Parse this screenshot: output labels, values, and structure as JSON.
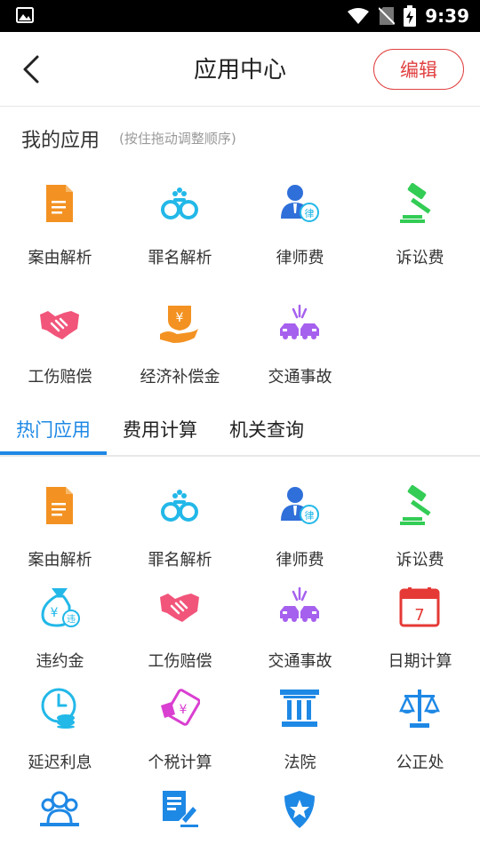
{
  "status_bar": {
    "time": "9:39"
  },
  "header": {
    "title": "应用中心",
    "edit_label": "编辑"
  },
  "my_apps": {
    "title": "我的应用",
    "hint": "(按住拖动调整顺序)",
    "items": [
      {
        "label": "案由解析",
        "icon": "document-icon"
      },
      {
        "label": "罪名解析",
        "icon": "handcuffs-icon"
      },
      {
        "label": "律师费",
        "icon": "lawyer-icon"
      },
      {
        "label": "诉讼费",
        "icon": "gavel-icon"
      },
      {
        "label": "工伤赔偿",
        "icon": "handshake-icon"
      },
      {
        "label": "经济补偿金",
        "icon": "money-hand-icon"
      },
      {
        "label": "交通事故",
        "icon": "car-crash-icon"
      }
    ]
  },
  "tabs": [
    {
      "label": "热门应用",
      "active": true
    },
    {
      "label": "费用计算",
      "active": false
    },
    {
      "label": "机关查询",
      "active": false
    }
  ],
  "hot_apps": {
    "items": [
      {
        "label": "案由解析",
        "icon": "document-icon"
      },
      {
        "label": "罪名解析",
        "icon": "handcuffs-icon"
      },
      {
        "label": "律师费",
        "icon": "lawyer-icon"
      },
      {
        "label": "诉讼费",
        "icon": "gavel-icon"
      },
      {
        "label": "违约金",
        "icon": "money-bag-icon"
      },
      {
        "label": "工伤赔偿",
        "icon": "handshake-icon"
      },
      {
        "label": "交通事故",
        "icon": "car-crash-icon"
      },
      {
        "label": "日期计算",
        "icon": "calendar-icon"
      },
      {
        "label": "延迟利息",
        "icon": "clock-coins-icon"
      },
      {
        "label": "个税计算",
        "icon": "tax-card-icon"
      },
      {
        "label": "法院",
        "icon": "court-pillar-icon"
      },
      {
        "label": "公正处",
        "icon": "scales-icon"
      },
      {
        "label": "",
        "icon": "people-icon"
      },
      {
        "label": "",
        "icon": "document-signature-icon"
      },
      {
        "label": "",
        "icon": "police-badge-icon"
      }
    ]
  },
  "colors": {
    "accent_blue": "#1e88e5",
    "edit_red": "#e04040",
    "orange": "#f39222",
    "cyan": "#22b8e8",
    "green": "#33cc55",
    "pink": "#f2557a",
    "purple": "#a660ee",
    "red": "#e53935",
    "magenta": "#d93fd0"
  },
  "calendar_day": "7"
}
